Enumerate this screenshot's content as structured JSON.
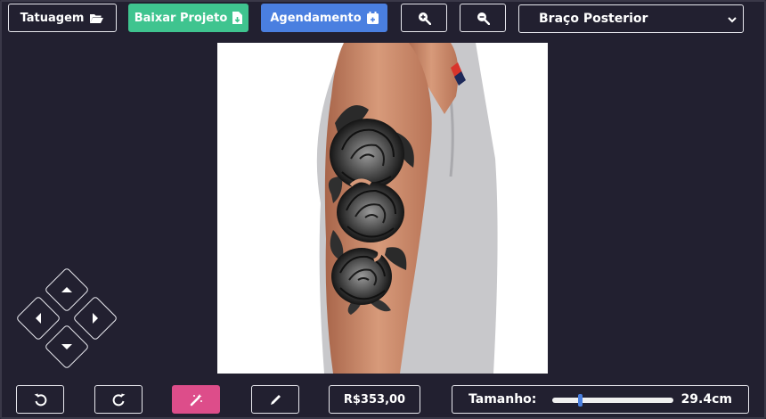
{
  "toolbar": {
    "tattoo_label": "Tatuagem",
    "download_label": "Baixar Projeto",
    "schedule_label": "Agendamento",
    "placement_selected": "Braço Posterior"
  },
  "bottom": {
    "price": "R$353,00",
    "size_label": "Tamanho:",
    "size_value": "29.4cm",
    "size_slider_fraction": 0.22
  },
  "icons": {
    "tattoo": "folder-open-icon",
    "download": "file-download-icon",
    "schedule": "calendar-plus-icon",
    "zoom_in": "zoom-in-icon",
    "zoom_out": "zoom-out-icon",
    "undo": "undo-icon",
    "redo": "redo-icon",
    "magic": "magic-wand-icon",
    "edit": "pencil-icon"
  },
  "colors": {
    "background": "#222030",
    "download": "#3fc48f",
    "schedule": "#4a7fe0",
    "magic": "#dd4d8a"
  }
}
